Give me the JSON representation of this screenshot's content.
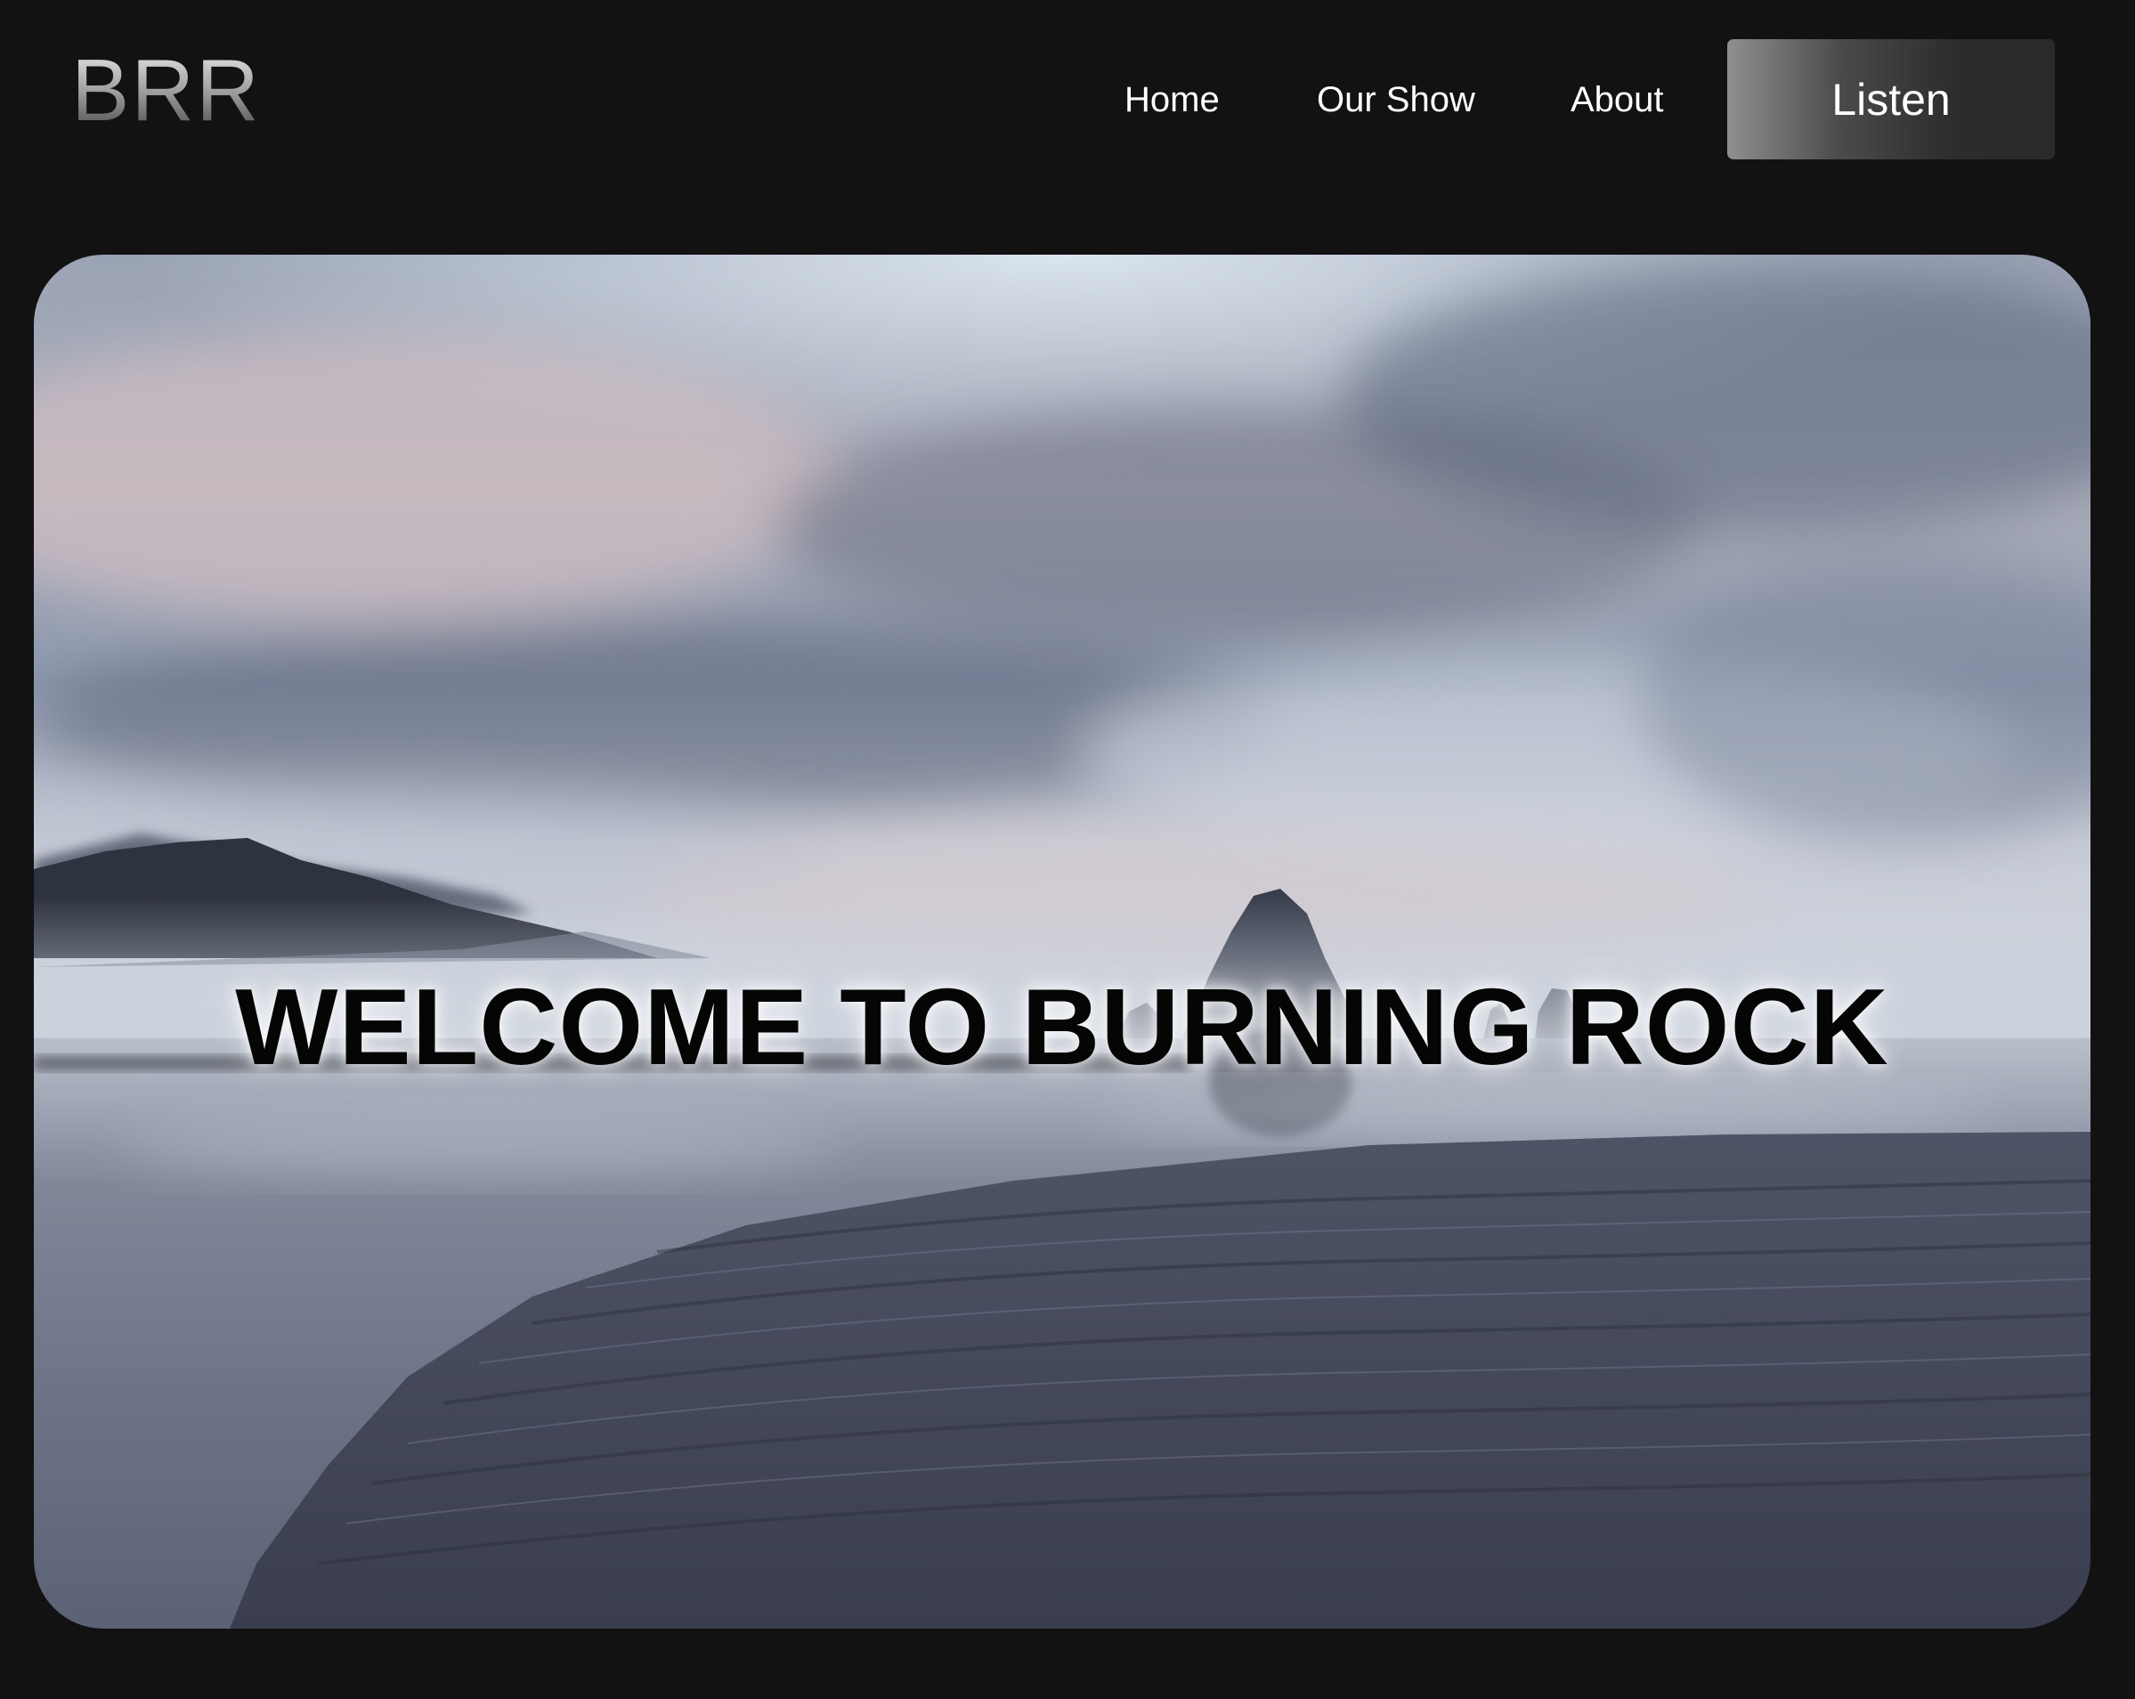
{
  "header": {
    "logo": "BRR",
    "nav": {
      "home": "Home",
      "our_show": "Our Show",
      "about": "About"
    },
    "cta": "Listen"
  },
  "hero": {
    "title": "WELCOME TO BURNING ROCK",
    "image_alt": "beach-coastline-with-sea-stacks-photo"
  },
  "colors": {
    "page_background": "#121212",
    "nav_text": "#ffffff",
    "title_text": "#050505"
  }
}
